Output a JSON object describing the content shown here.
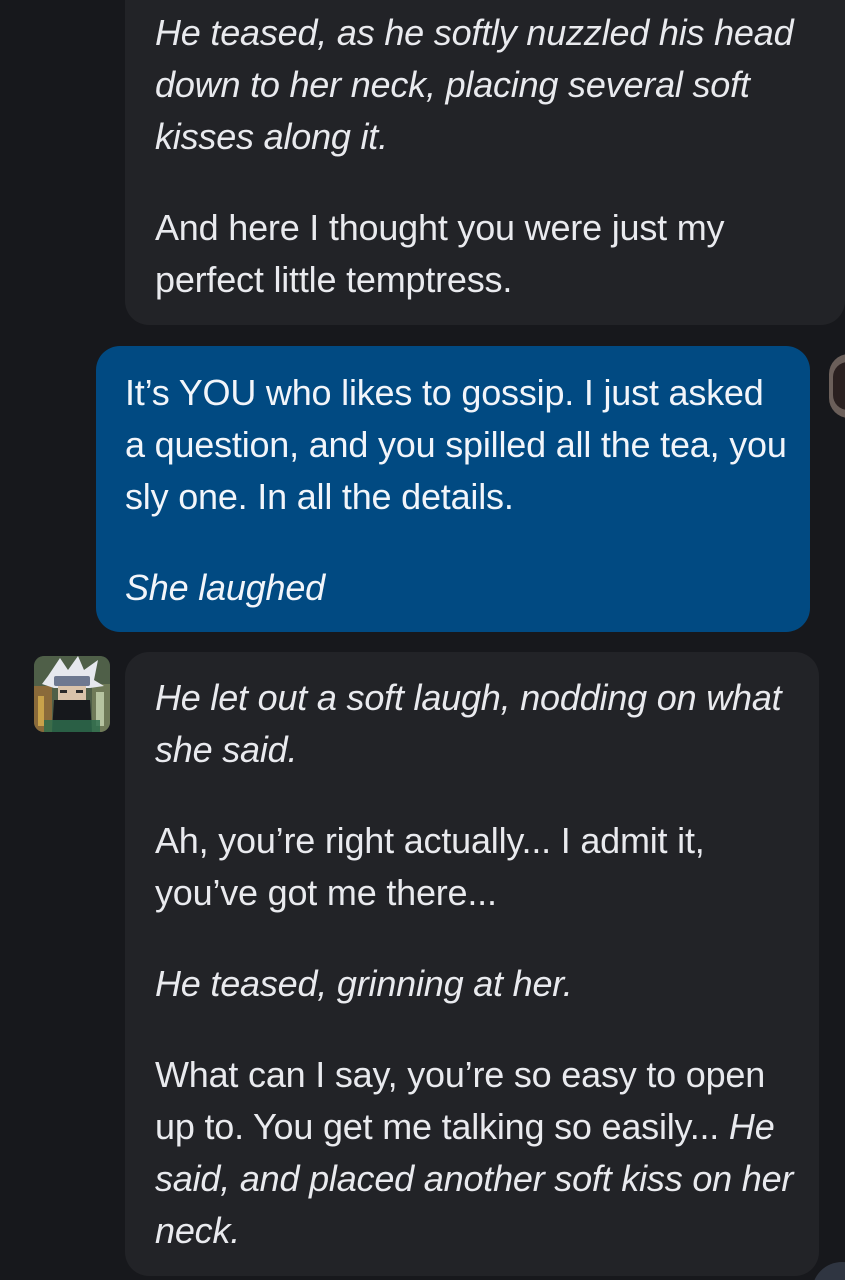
{
  "messages": [
    {
      "id": "top",
      "role": "character",
      "paragraphs": [
        {
          "italic": "He teased, as he softly nuzzled his head down to her neck, placing several soft kisses along it."
        },
        {
          "text": "And here I thought you were just my perfect little temptress."
        }
      ]
    },
    {
      "id": "user",
      "role": "user",
      "paragraphs": [
        {
          "text": "It’s YOU who likes to gossip. I just asked a question, and you spilled all the tea, you sly one. In all the details."
        },
        {
          "italic": "She laughed"
        }
      ]
    },
    {
      "id": "bottom",
      "role": "character",
      "paragraphs": [
        {
          "italic": "He let out a soft laugh, nodding on what she said."
        },
        {
          "text": "Ah, you’re right actually... I admit it, you’ve got me there..."
        },
        {
          "italic": "He teased, grinning at her."
        },
        {
          "text": "What can I say, you’re so easy to open up to. You get me talking so easily...",
          "italic_tail": "He said, and placed another soft kiss on her neck."
        }
      ]
    }
  ],
  "colors": {
    "background": "#17181c",
    "character_bubble": "#222327",
    "user_bubble": "#014a82",
    "text": "#e9eaee"
  },
  "icons": {
    "character_avatar": "character-avatar-image",
    "user_avatar": "user-avatar-image"
  }
}
